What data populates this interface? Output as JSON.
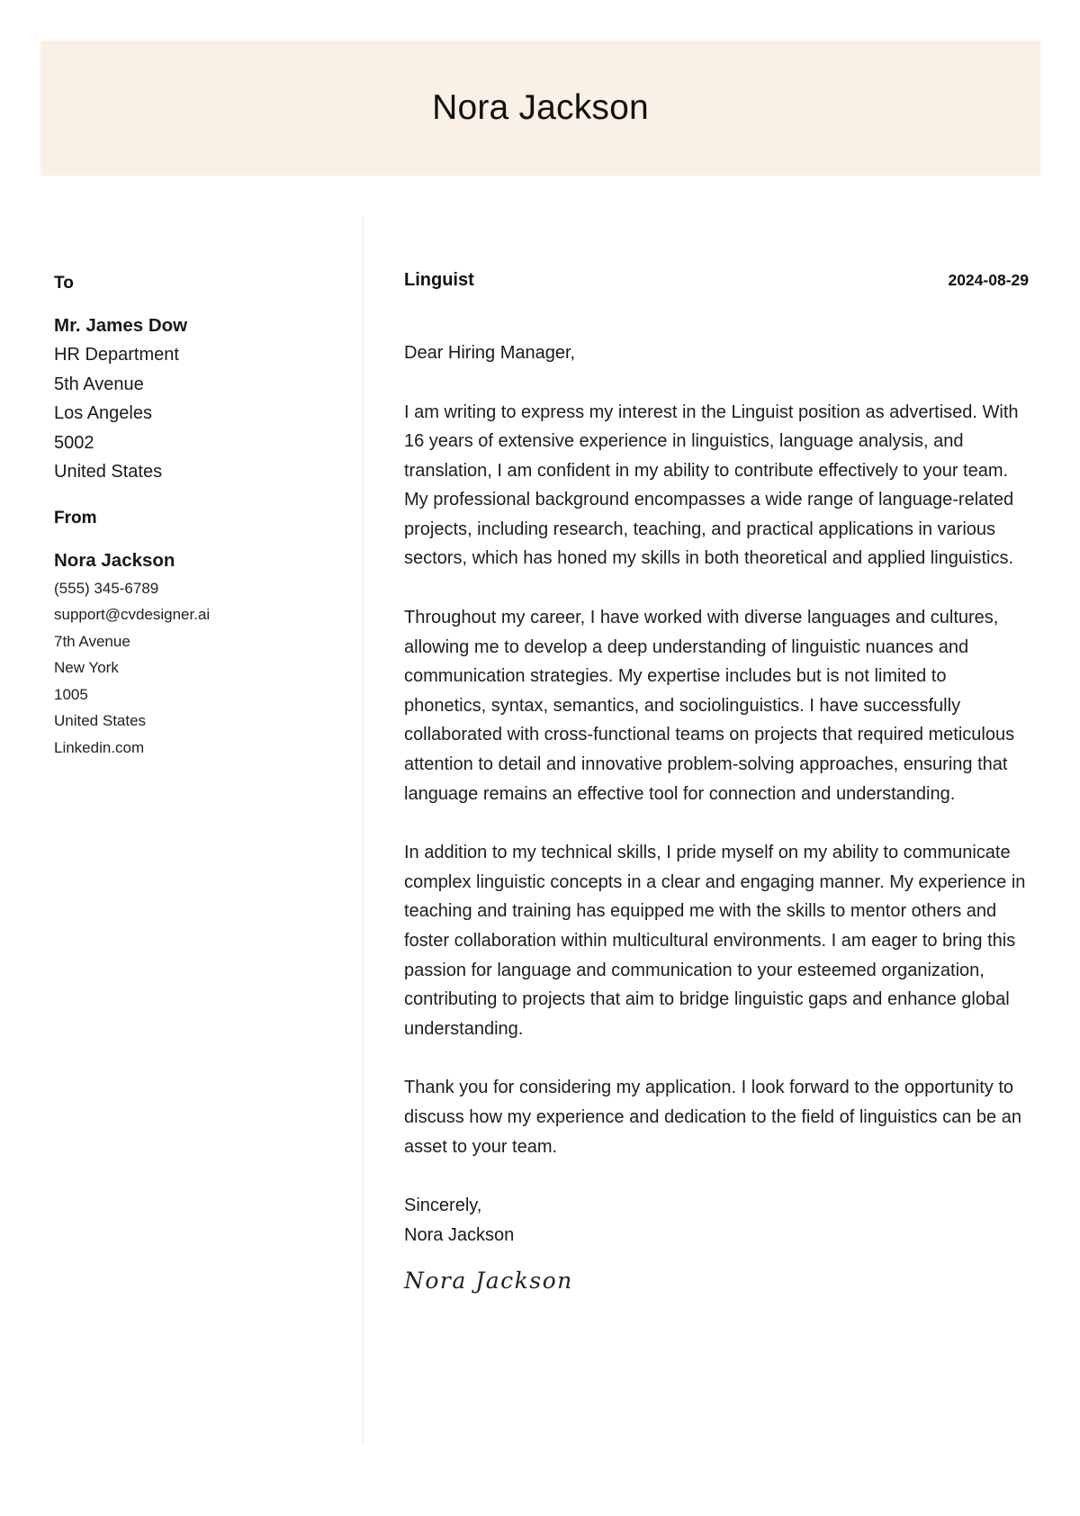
{
  "header": {
    "name": "Nora Jackson"
  },
  "recipient": {
    "label": "To",
    "name": "Mr. James Dow",
    "lines": [
      "HR Department",
      "5th Avenue",
      "Los Angeles",
      "5002",
      "United States"
    ]
  },
  "sender": {
    "label": "From",
    "name": "Nora Jackson",
    "lines": [
      "(555) 345-6789",
      "support@cvdesigner.ai",
      "7th Avenue",
      "New York",
      "1005",
      "United States",
      "Linkedin.com"
    ]
  },
  "letter": {
    "job_title": "Linguist",
    "date": "2024-08-29",
    "greeting": "Dear Hiring Manager,",
    "paragraphs": [
      "I am writing to express my interest in the Linguist position as advertised. With 16 years of extensive experience in linguistics, language analysis, and translation, I am confident in my ability to contribute effectively to your team. My professional background encompasses a wide range of language-related projects, including research, teaching, and practical applications in various sectors, which has honed my skills in both theoretical and applied linguistics.",
      "Throughout my career, I have worked with diverse languages and cultures, allowing me to develop a deep understanding of linguistic nuances and communication strategies. My expertise includes but is not limited to phonetics, syntax, semantics, and sociolinguistics. I have successfully collaborated with cross-functional teams on projects that required meticulous attention to detail and innovative problem-solving approaches, ensuring that language remains an effective tool for connection and understanding.",
      "In addition to my technical skills, I pride myself on my ability to communicate complex linguistic concepts in a clear and engaging manner. My experience in teaching and training has equipped me with the skills to mentor others and foster collaboration within multicultural environments. I am eager to bring this passion for language and communication to your esteemed organization, contributing to projects that aim to bridge linguistic gaps and enhance global understanding.",
      "Thank you for considering my application. I look forward to the opportunity to discuss how my experience and dedication to the field of linguistics can be an asset to your team."
    ],
    "closing": "Sincerely,",
    "closing_name": "Nora Jackson",
    "signature": "Nora Jackson"
  }
}
